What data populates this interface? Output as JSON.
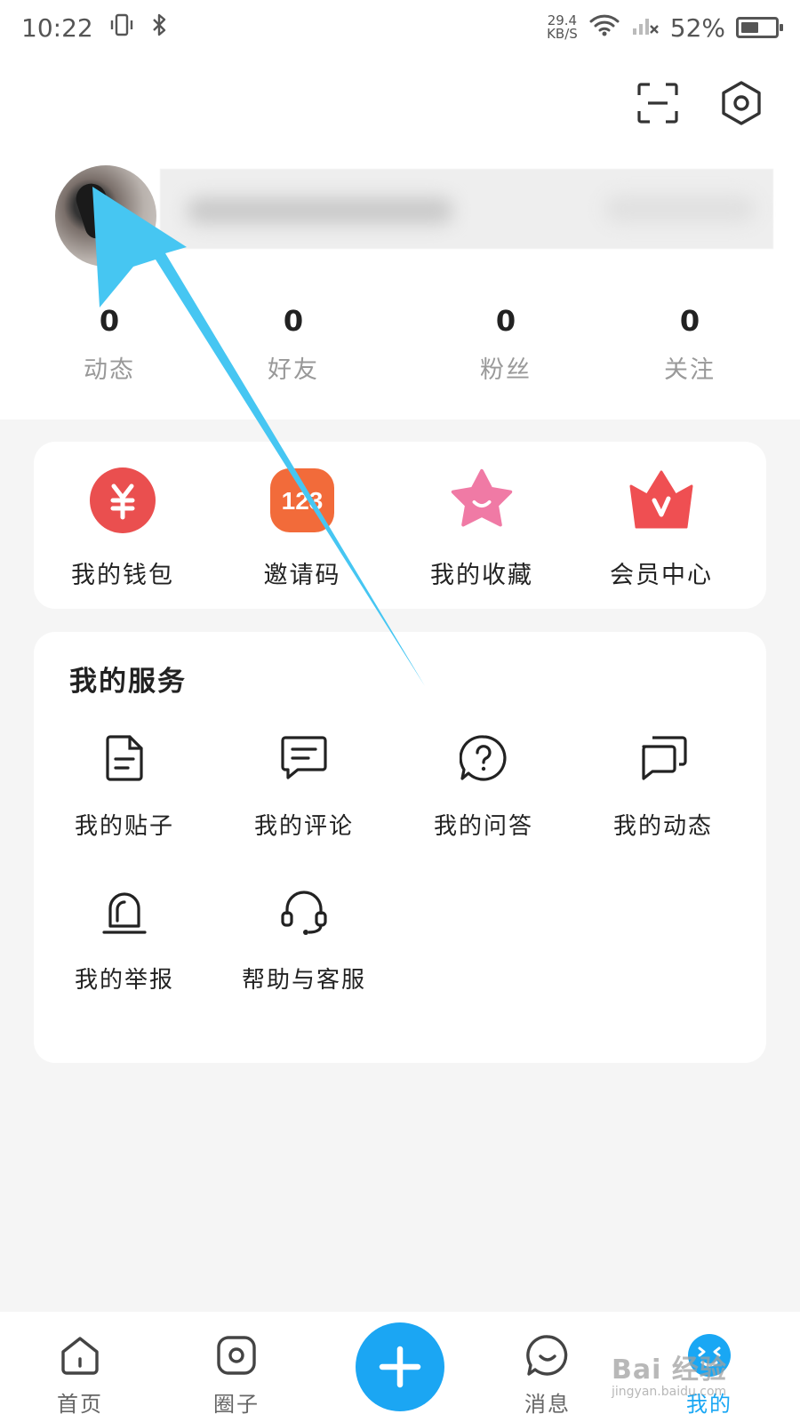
{
  "status_bar": {
    "time": "10:22",
    "net_speed_value": "29.4",
    "net_speed_unit": "KB/S",
    "battery": "52%",
    "battery_level": 0.52
  },
  "profile": {
    "stats": [
      {
        "value": "0",
        "label": "动态"
      },
      {
        "value": "0",
        "label": "好友"
      },
      {
        "value": "0",
        "label": "粉丝"
      },
      {
        "value": "0",
        "label": "关注"
      }
    ]
  },
  "quick_actions": [
    {
      "label": "我的钱包",
      "icon": "wallet-icon",
      "color": "#ea4f4f"
    },
    {
      "label": "邀请码",
      "icon": "invite-code-icon",
      "color": "#f26b3a",
      "icon_text": "123"
    },
    {
      "label": "我的收藏",
      "icon": "star-icon",
      "color": "#f07aa5"
    },
    {
      "label": "会员中心",
      "icon": "crown-icon",
      "color": "#ef4f52"
    }
  ],
  "services": {
    "title": "我的服务",
    "items": [
      {
        "label": "我的贴子",
        "icon": "document-icon"
      },
      {
        "label": "我的评论",
        "icon": "comment-icon"
      },
      {
        "label": "我的问答",
        "icon": "question-icon"
      },
      {
        "label": "我的动态",
        "icon": "chat-bubbles-icon"
      },
      {
        "label": "我的举报",
        "icon": "alarm-icon"
      },
      {
        "label": "帮助与客服",
        "icon": "headset-icon"
      }
    ]
  },
  "tabbar": {
    "tabs": [
      {
        "label": "首页",
        "icon": "home-icon"
      },
      {
        "label": "圈子",
        "icon": "circle-icon"
      },
      {
        "label": "消息",
        "icon": "message-icon"
      },
      {
        "label": "我的",
        "icon": "profile-face-icon",
        "active": true
      }
    ],
    "accent": "#1ba6f3"
  },
  "watermark": {
    "text": "Bai 经验",
    "sub": "jingyan.baidu.com"
  }
}
